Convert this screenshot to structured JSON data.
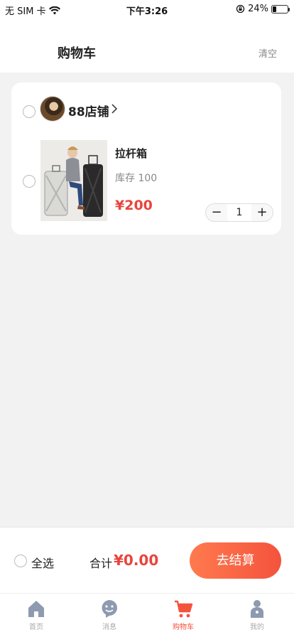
{
  "status_bar": {
    "carrier": "无 SIM 卡",
    "time": "下午3:26",
    "battery": "24%",
    "battery_level": 0.24
  },
  "nav": {
    "title": "购物车",
    "clear_label": "清空"
  },
  "store": {
    "name": "88店铺",
    "product": {
      "name": "拉杆箱",
      "stock": "库存 100",
      "price": "¥200",
      "quantity": "1",
      "decrement": "−",
      "increment": "+"
    }
  },
  "checkout": {
    "select_all_label": "全选",
    "total_label": "合计",
    "total_value": "¥0.00",
    "checkout_label": "去结算"
  },
  "tabs": [
    {
      "label": "首页",
      "icon": "home-icon"
    },
    {
      "label": "消息",
      "icon": "message-icon"
    },
    {
      "label": "购物车",
      "icon": "cart-icon",
      "active": true
    },
    {
      "label": "我的",
      "icon": "profile-icon"
    }
  ],
  "colors": {
    "accent": "#f4533c",
    "price": "#e8453c",
    "inactive_tab": "#aaaaaa"
  }
}
